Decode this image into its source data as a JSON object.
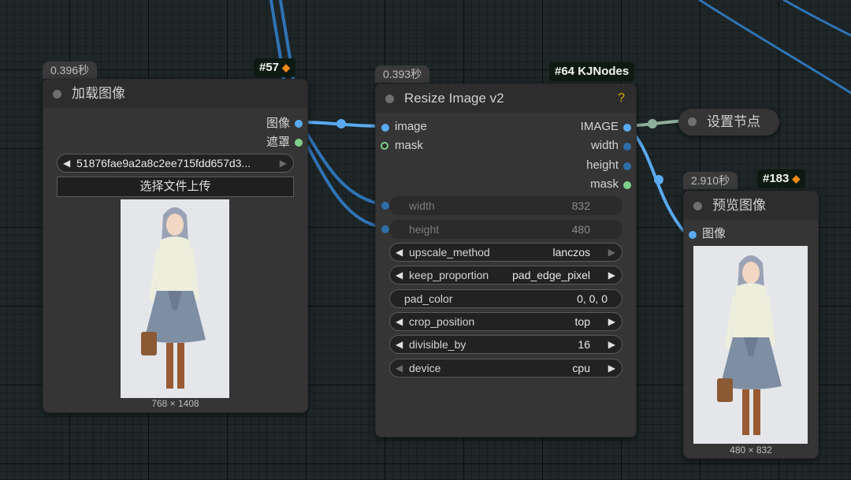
{
  "node_load": {
    "timing": "0.396秒",
    "badge": "#57",
    "title": "加载图像",
    "outputs": [
      "图像",
      "遮罩"
    ],
    "file_value": "51876fae9a2a8c2ee715fdd657d3...",
    "upload_label": "选择文件上传",
    "image_size": "768 × 1408"
  },
  "node_resize": {
    "timing": "0.393秒",
    "badge": "#64 KJNodes",
    "title": "Resize Image v2",
    "help": "?",
    "inputs": [
      "image",
      "mask"
    ],
    "outputs": [
      "IMAGE",
      "width",
      "height",
      "mask"
    ],
    "widgets": [
      {
        "label": "width",
        "value": "832",
        "dim": true
      },
      {
        "label": "height",
        "value": "480",
        "dim": true
      },
      {
        "label": "upscale_method",
        "value": "lanczos",
        "dim": false
      },
      {
        "label": "keep_proportion",
        "value": "pad_edge_pixel",
        "dim": false
      },
      {
        "label": "pad_color",
        "value": "0, 0, 0",
        "dim": false
      },
      {
        "label": "crop_position",
        "value": "top",
        "dim": false
      },
      {
        "label": "divisible_by",
        "value": "16",
        "dim": false
      },
      {
        "label": "device",
        "value": "cpu",
        "dim": false
      }
    ]
  },
  "node_setnode": {
    "title": "设置节点"
  },
  "node_preview": {
    "timing": "2.910秒",
    "badge": "#183",
    "title": "预览图像",
    "input": "图像",
    "image_size": "480 × 832"
  },
  "colors": {
    "wire_image": "#5aaaf0",
    "wire_int": "#2e6ea8",
    "wire_mask": "#7dd08a",
    "accent_help": "#e0a800"
  },
  "icons": {
    "badge_icon": "fox-icon",
    "arrow_left": "triangle-left-icon",
    "arrow_right": "triangle-right-icon"
  }
}
